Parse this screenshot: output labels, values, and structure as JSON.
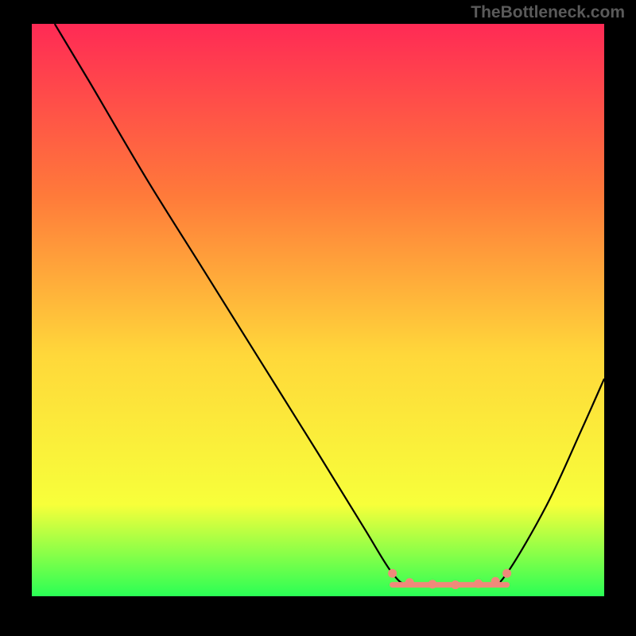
{
  "attribution": "TheBottleneck.com",
  "chart_data": {
    "type": "line",
    "title": "",
    "xlabel": "",
    "ylabel": "",
    "x_range": [
      0,
      100
    ],
    "y_range": [
      0,
      100
    ],
    "gradient_colors": {
      "top": "#ff2a55",
      "mid_upper": "#ff7a3a",
      "mid": "#ffd83a",
      "mid_lower": "#f7ff3a",
      "bottom": "#2aff55"
    },
    "curve": [
      {
        "x": 4,
        "y": 100
      },
      {
        "x": 10,
        "y": 90
      },
      {
        "x": 20,
        "y": 73
      },
      {
        "x": 30,
        "y": 57
      },
      {
        "x": 40,
        "y": 41
      },
      {
        "x": 50,
        "y": 25
      },
      {
        "x": 58,
        "y": 12
      },
      {
        "x": 63,
        "y": 4
      },
      {
        "x": 66,
        "y": 2
      },
      {
        "x": 73,
        "y": 2
      },
      {
        "x": 80,
        "y": 2
      },
      {
        "x": 83,
        "y": 4
      },
      {
        "x": 90,
        "y": 16
      },
      {
        "x": 96,
        "y": 29
      },
      {
        "x": 100,
        "y": 38
      }
    ],
    "flat_segment": {
      "x_start": 63,
      "x_end": 83,
      "y": 2,
      "color": "#f08a7a"
    },
    "marker_clusters": [
      {
        "x": 63,
        "y": 4,
        "color": "#f08a7a"
      },
      {
        "x": 66,
        "y": 2.4,
        "color": "#f08a7a"
      },
      {
        "x": 70,
        "y": 2.1,
        "color": "#f08a7a"
      },
      {
        "x": 74,
        "y": 2.0,
        "color": "#f08a7a"
      },
      {
        "x": 78,
        "y": 2.2,
        "color": "#f08a7a"
      },
      {
        "x": 81,
        "y": 2.6,
        "color": "#f08a7a"
      },
      {
        "x": 83,
        "y": 4,
        "color": "#f08a7a"
      }
    ]
  }
}
